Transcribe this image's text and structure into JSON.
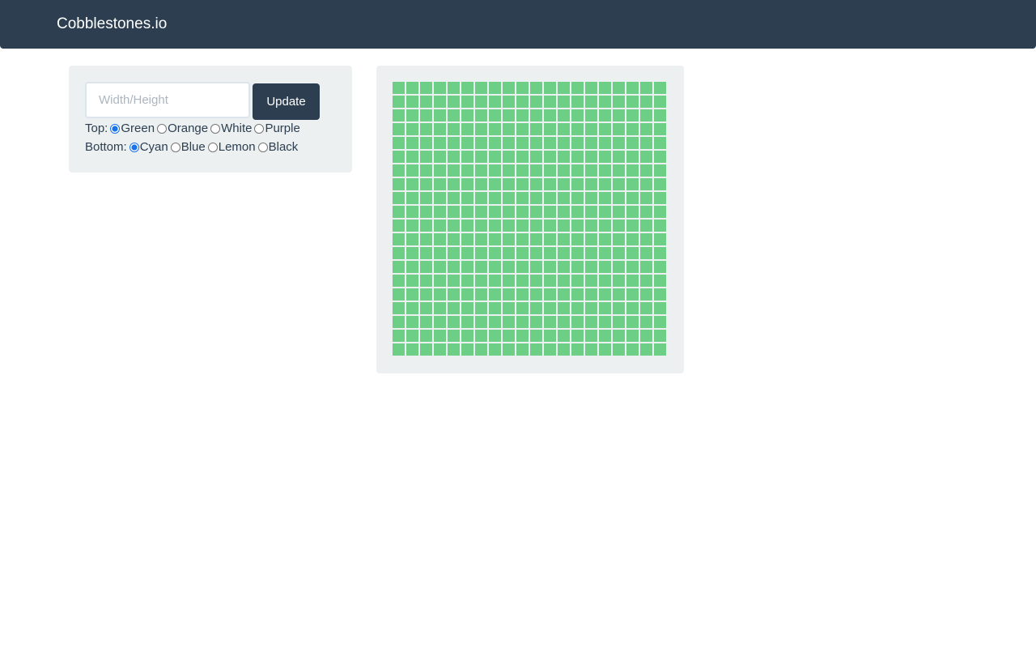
{
  "navbar": {
    "brand": "Cobblestones.io"
  },
  "controls": {
    "size_placeholder": "Width/Height",
    "size_value": "",
    "update_label": "Update",
    "top": {
      "label": "Top:",
      "options": [
        "Green",
        "Orange",
        "White",
        "Purple"
      ],
      "selected": "Green"
    },
    "bottom": {
      "label": "Bottom:",
      "options": [
        "Cyan",
        "Blue",
        "Lemon",
        "Black"
      ],
      "selected": "Cyan"
    }
  },
  "grid": {
    "columns": 20,
    "rows": 20,
    "cell_color": "#6ccf85"
  },
  "colors": {
    "navbar": "#2c3e50",
    "panel": "#ecf0f1",
    "accent": "#2c3e50"
  }
}
